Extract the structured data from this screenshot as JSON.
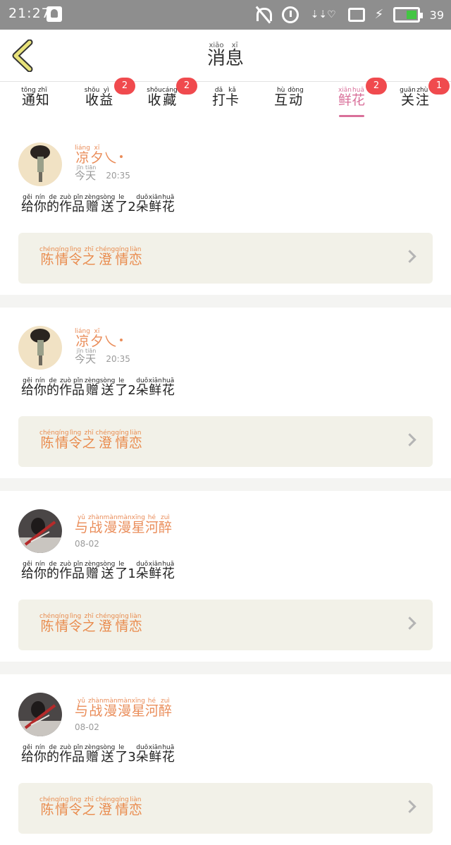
{
  "status_bar": {
    "time": "21:27",
    "battery_level": "39",
    "icons": [
      "qq-icon",
      "mute-icon",
      "alarm-icon",
      "wifi-icon",
      "tablet-icon",
      "charging-icon",
      "battery-icon"
    ],
    "battery_color": "#43c543"
  },
  "header": {
    "title": [
      {
        "hz": "消",
        "py": "xiāo"
      },
      {
        "hz": "息",
        "py": "xī"
      }
    ]
  },
  "tabs": [
    {
      "label": [
        {
          "hz": "通",
          "py": "tōng"
        },
        {
          "hz": "知",
          "py": "zhī"
        }
      ],
      "badge": ""
    },
    {
      "label": [
        {
          "hz": "收",
          "py": "shōu"
        },
        {
          "hz": "益",
          "py": "yì"
        }
      ],
      "badge": "2"
    },
    {
      "label": [
        {
          "hz": "收",
          "py": "shōu"
        },
        {
          "hz": "藏",
          "py": "cáng"
        }
      ],
      "badge": "2"
    },
    {
      "label": [
        {
          "hz": "打",
          "py": "dǎ"
        },
        {
          "hz": "卡",
          "py": "kǎ"
        }
      ],
      "badge": ""
    },
    {
      "label": [
        {
          "hz": "互",
          "py": "hù"
        },
        {
          "hz": "动",
          "py": "dòng"
        }
      ],
      "badge": ""
    },
    {
      "label": [
        {
          "hz": "鲜",
          "py": "xiān"
        },
        {
          "hz": "花",
          "py": "huā"
        }
      ],
      "badge": "2",
      "active": true
    },
    {
      "label": [
        {
          "hz": "关",
          "py": "guān"
        },
        {
          "hz": "注",
          "py": "zhù"
        }
      ],
      "badge": "1"
    }
  ],
  "colors": {
    "accent": "#d9709a",
    "name": "#ea8d5a",
    "badge": "#f04a4e",
    "work_bg": "#f2f1e8"
  },
  "items": [
    {
      "avatar": "avatar-light",
      "name": [
        {
          "hz": "凉",
          "py": "liáng"
        },
        {
          "hz": "夕",
          "py": "xī"
        },
        {
          "hz": "乀",
          "py": ""
        }
      ],
      "name_dot": true,
      "date_ruby": [
        {
          "hz": "今",
          "py": "jīn"
        },
        {
          "hz": "天",
          "py": "tiān"
        }
      ],
      "time": "20:35",
      "message": [
        {
          "hz": "给",
          "py": "gěi"
        },
        {
          "hz": "你",
          "py": "nín"
        },
        {
          "hz": "的",
          "py": "de"
        },
        {
          "hz": "作",
          "py": "zuò"
        },
        {
          "hz": "品",
          "py": "pǐn"
        },
        {
          "hz": "赠",
          "py": "zèng"
        },
        {
          "hz": "送",
          "py": "sòng"
        },
        {
          "hz": "了",
          "py": "le"
        },
        {
          "hz": "2",
          "py": ""
        },
        {
          "hz": "朵",
          "py": "duǒ"
        },
        {
          "hz": "鲜",
          "py": "xiān"
        },
        {
          "hz": "花",
          "py": "huā"
        }
      ],
      "work": [
        {
          "hz": "陈",
          "py": "chén"
        },
        {
          "hz": "情",
          "py": "qíng"
        },
        {
          "hz": "令",
          "py": "lìng"
        },
        {
          "hz": "之",
          "py": "zhī"
        },
        {
          "hz": "澄",
          "py": "chéng"
        },
        {
          "hz": "情",
          "py": "qíng"
        },
        {
          "hz": "恋",
          "py": "liàn"
        }
      ]
    },
    {
      "avatar": "avatar-light",
      "name": [
        {
          "hz": "凉",
          "py": "liáng"
        },
        {
          "hz": "夕",
          "py": "xī"
        },
        {
          "hz": "乀",
          "py": ""
        }
      ],
      "name_dot": true,
      "date_ruby": [
        {
          "hz": "今",
          "py": "jīn"
        },
        {
          "hz": "天",
          "py": "tiān"
        }
      ],
      "time": "20:35",
      "message": [
        {
          "hz": "给",
          "py": "gěi"
        },
        {
          "hz": "你",
          "py": "nín"
        },
        {
          "hz": "的",
          "py": "de"
        },
        {
          "hz": "作",
          "py": "zuò"
        },
        {
          "hz": "品",
          "py": "pǐn"
        },
        {
          "hz": "赠",
          "py": "zèng"
        },
        {
          "hz": "送",
          "py": "sòng"
        },
        {
          "hz": "了",
          "py": "le"
        },
        {
          "hz": "2",
          "py": ""
        },
        {
          "hz": "朵",
          "py": "duǒ"
        },
        {
          "hz": "鲜",
          "py": "xiān"
        },
        {
          "hz": "花",
          "py": "huā"
        }
      ],
      "work": [
        {
          "hz": "陈",
          "py": "chén"
        },
        {
          "hz": "情",
          "py": "qíng"
        },
        {
          "hz": "令",
          "py": "lìng"
        },
        {
          "hz": "之",
          "py": "zhī"
        },
        {
          "hz": "澄",
          "py": "chéng"
        },
        {
          "hz": "情",
          "py": "qíng"
        },
        {
          "hz": "恋",
          "py": "liàn"
        }
      ]
    },
    {
      "avatar": "avatar-dark",
      "name": [
        {
          "hz": "与",
          "py": "yǔ"
        },
        {
          "hz": "战",
          "py": "zhàn"
        },
        {
          "hz": "漫",
          "py": "màn"
        },
        {
          "hz": "漫",
          "py": "màn"
        },
        {
          "hz": "星",
          "py": "xīng"
        },
        {
          "hz": "河",
          "py": "hé"
        },
        {
          "hz": "醉",
          "py": "zuì"
        }
      ],
      "name_dot": false,
      "date_ruby": [],
      "time": "08-02",
      "message": [
        {
          "hz": "给",
          "py": "gěi"
        },
        {
          "hz": "你",
          "py": "nín"
        },
        {
          "hz": "的",
          "py": "de"
        },
        {
          "hz": "作",
          "py": "zuò"
        },
        {
          "hz": "品",
          "py": "pǐn"
        },
        {
          "hz": "赠",
          "py": "zèng"
        },
        {
          "hz": "送",
          "py": "sòng"
        },
        {
          "hz": "了",
          "py": "le"
        },
        {
          "hz": "1",
          "py": ""
        },
        {
          "hz": "朵",
          "py": "duǒ"
        },
        {
          "hz": "鲜",
          "py": "xiān"
        },
        {
          "hz": "花",
          "py": "huā"
        }
      ],
      "work": [
        {
          "hz": "陈",
          "py": "chén"
        },
        {
          "hz": "情",
          "py": "qíng"
        },
        {
          "hz": "令",
          "py": "lìng"
        },
        {
          "hz": "之",
          "py": "zhī"
        },
        {
          "hz": "澄",
          "py": "chéng"
        },
        {
          "hz": "情",
          "py": "qíng"
        },
        {
          "hz": "恋",
          "py": "liàn"
        }
      ]
    },
    {
      "avatar": "avatar-dark",
      "name": [
        {
          "hz": "与",
          "py": "yǔ"
        },
        {
          "hz": "战",
          "py": "zhàn"
        },
        {
          "hz": "漫",
          "py": "màn"
        },
        {
          "hz": "漫",
          "py": "màn"
        },
        {
          "hz": "星",
          "py": "xīng"
        },
        {
          "hz": "河",
          "py": "hé"
        },
        {
          "hz": "醉",
          "py": "zuì"
        }
      ],
      "name_dot": false,
      "date_ruby": [],
      "time": "08-02",
      "message": [
        {
          "hz": "给",
          "py": "gěi"
        },
        {
          "hz": "你",
          "py": "nín"
        },
        {
          "hz": "的",
          "py": "de"
        },
        {
          "hz": "作",
          "py": "zuò"
        },
        {
          "hz": "品",
          "py": "pǐn"
        },
        {
          "hz": "赠",
          "py": "zèng"
        },
        {
          "hz": "送",
          "py": "sòng"
        },
        {
          "hz": "了",
          "py": "le"
        },
        {
          "hz": "3",
          "py": ""
        },
        {
          "hz": "朵",
          "py": "duǒ"
        },
        {
          "hz": "鲜",
          "py": "xiān"
        },
        {
          "hz": "花",
          "py": "huā"
        }
      ],
      "work": [
        {
          "hz": "陈",
          "py": "chén"
        },
        {
          "hz": "情",
          "py": "qíng"
        },
        {
          "hz": "令",
          "py": "lìng"
        },
        {
          "hz": "之",
          "py": "zhī"
        },
        {
          "hz": "澄",
          "py": "chéng"
        },
        {
          "hz": "情",
          "py": "qíng"
        },
        {
          "hz": "恋",
          "py": "liàn"
        }
      ]
    }
  ]
}
